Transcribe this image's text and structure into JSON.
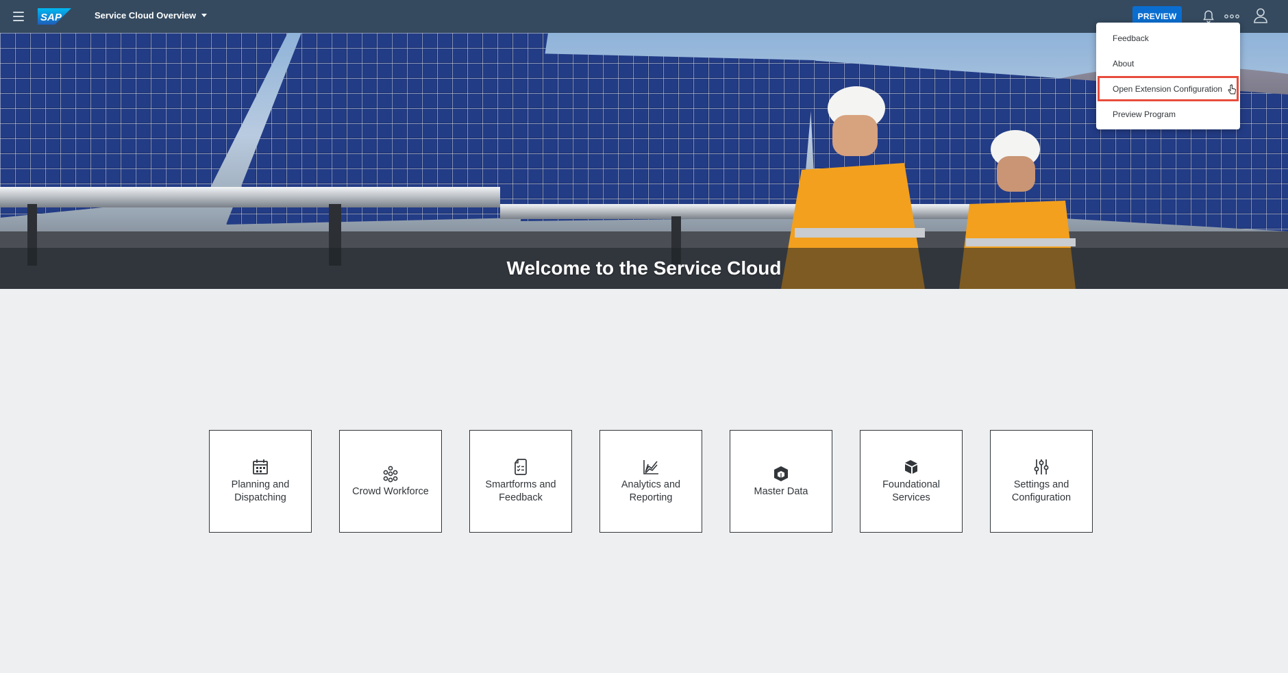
{
  "shell": {
    "app_title": "Service Cloud Overview",
    "preview_label": "PREVIEW",
    "accent_color": "#0a6ed1",
    "bar_color": "#354a5f",
    "icons": [
      "menu-icon",
      "sap-logo",
      "bell-icon",
      "more-icon",
      "user-icon"
    ]
  },
  "hero": {
    "title": "Welcome to the Service Cloud"
  },
  "menu": {
    "items": [
      {
        "label": "Feedback"
      },
      {
        "label": "About"
      },
      {
        "label": "Open Extension Configuration"
      },
      {
        "label": "Preview Program"
      }
    ],
    "highlight_color": "#e84c3d"
  },
  "tiles": [
    {
      "label": "Planning and Dispatching",
      "icon": "calendar-icon"
    },
    {
      "label": "Crowd Workforce",
      "icon": "network-icon"
    },
    {
      "label": "Smartforms and Feedback",
      "icon": "checklist-document-icon"
    },
    {
      "label": "Analytics and Reporting",
      "icon": "area-chart-icon"
    },
    {
      "label": "Master Data",
      "icon": "cube-icon"
    },
    {
      "label": "Foundational Services",
      "icon": "layers-icon"
    },
    {
      "label": "Settings and Configuration",
      "icon": "sliders-icon"
    }
  ]
}
